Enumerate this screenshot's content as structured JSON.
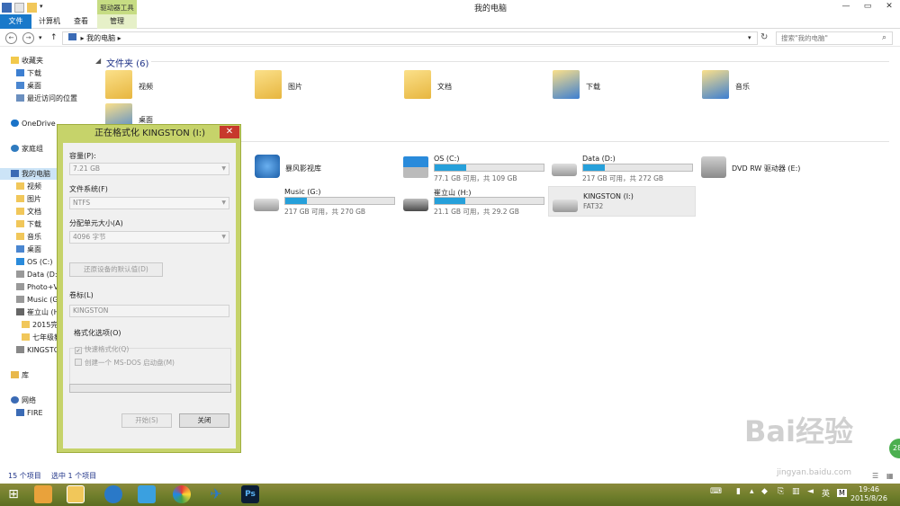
{
  "window": {
    "title": "我的电脑",
    "context_group": "驱动器工具"
  },
  "ribbon": {
    "tabs": [
      "文件",
      "计算机",
      "查看"
    ],
    "manage": "管理"
  },
  "address": {
    "path": "我的电脑",
    "search_placeholder": "搜索\"我的电脑\""
  },
  "nav": {
    "favorites": "收藏夹",
    "downloads": "下载",
    "desktop": "桌面",
    "recent": "最近访问的位置",
    "onedrive": "OneDrive",
    "homegroup": "家庭组",
    "thispc": "我的电脑",
    "videos": "视频",
    "pictures": "图片",
    "docs": "文档",
    "dl2": "下载",
    "music": "音乐",
    "desk2": "桌面",
    "osc": "OS (C:)",
    "datad": "Data (D:)",
    "photov": "Photo+V",
    "musicg": "Music (G",
    "cuili": "崔立山 (H",
    "f2015": "2015完",
    "fqn": "七年级教",
    "kingston": "KINGSTO",
    "libs": "库",
    "network": "网络",
    "fire": "FIRE"
  },
  "content": {
    "folders_header": "文件夹 (6)",
    "folders": [
      "视频",
      "图片",
      "文档",
      "下载",
      "音乐",
      "桌面"
    ],
    "drives": [
      {
        "name": "暴风影视库",
        "info": ""
      },
      {
        "name": "OS (C:)",
        "info": "77.1 GB 可用，共 109 GB",
        "used": 0.29
      },
      {
        "name": "Data (D:)",
        "info": "217 GB 可用，共 272 GB",
        "used": 0.2
      },
      {
        "name": "DVD RW 驱动器 (E:)",
        "info": ""
      },
      {
        "name": "Music (G:)",
        "info": "217 GB 可用，共 270 GB",
        "used": 0.2
      },
      {
        "name": "崔立山 (H:)",
        "info": "21.1 GB 可用，共 29.2 GB",
        "used": 0.28
      },
      {
        "name": "KINGSTON (I:)",
        "info": "FAT32"
      }
    ]
  },
  "status": {
    "count": "15 个项目",
    "selected": "选中 1 个项目"
  },
  "dialog": {
    "title": "正在格式化 KINGSTON (I:)",
    "capacity_label": "容量(P):",
    "capacity": "7.21 GB",
    "fs_label": "文件系统(F)",
    "fs": "NTFS",
    "alloc_label": "分配单元大小(A)",
    "alloc": "4096 字节",
    "restore": "还原设备的默认值(D)",
    "volume_label": "卷标(L)",
    "volume": "KINGSTON",
    "options_label": "格式化选项(O)",
    "quick": "快速格式化(Q)",
    "msdos": "创建一个 MS-DOS 启动盘(M)",
    "start": "开始(S)",
    "close": "关闭"
  },
  "taskbar": {
    "time": "19:46",
    "date": "2015/8/26",
    "ime": "英",
    "m": "M"
  },
  "watermark": {
    "text": "Bai经验",
    "url": "jingyan.baidu.com",
    "badge": "28"
  }
}
